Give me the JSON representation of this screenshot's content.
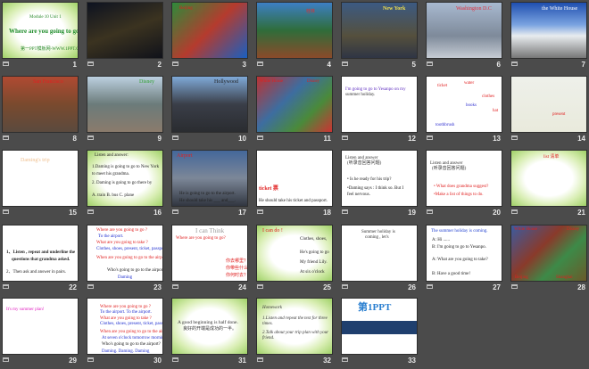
{
  "app": "slide-sorter",
  "slides": [
    {
      "num": "1",
      "kind": "green",
      "texts": [
        {
          "t": "Module 10 Unit 1",
          "c": "#2a8a2a",
          "x": 30,
          "y": 14
        },
        {
          "t": "Where are you going to go?",
          "c": "#1e8c2a",
          "x": 7,
          "y": 28,
          "b": 1,
          "s": 7
        },
        {
          "t": "第一PPT模板网-WWW.1PPT.COM",
          "c": "#2a8a2a",
          "x": 20,
          "y": 50
        }
      ]
    },
    {
      "num": "2",
      "kind": "photo1",
      "texts": []
    },
    {
      "num": "3",
      "kind": "photo2",
      "texts": [
        {
          "t": "Beijing",
          "c": "#e02020",
          "x": 8,
          "y": 4
        }
      ]
    },
    {
      "num": "4",
      "kind": "photo3",
      "texts": [
        {
          "t": "桂林",
          "c": "#e03030",
          "x": 55,
          "y": 8
        }
      ]
    },
    {
      "num": "5",
      "kind": "photo4",
      "texts": [
        {
          "t": "New York",
          "c": "#f0e050",
          "x": 46,
          "y": 4,
          "b": 1,
          "s": 6
        }
      ]
    },
    {
      "num": "6",
      "kind": "photo5",
      "texts": [
        {
          "t": "Washington D.C",
          "c": "#e03040",
          "x": 33,
          "y": 4,
          "s": 6
        }
      ]
    },
    {
      "num": "7",
      "kind": "photo6",
      "texts": [
        {
          "t": "the White House",
          "c": "#ffffff",
          "x": 34,
          "y": 4,
          "s": 6
        }
      ]
    },
    {
      "num": "8",
      "kind": "photo7",
      "texts": [
        {
          "t": "San Francisco",
          "c": "#e02020",
          "x": 34,
          "y": 3,
          "s": 6
        }
      ]
    },
    {
      "num": "9",
      "kind": "photo8",
      "texts": [
        {
          "t": "Disney",
          "c": "#30a030",
          "x": 58,
          "y": 3,
          "s": 6
        }
      ]
    },
    {
      "num": "10",
      "kind": "photo9",
      "texts": [
        {
          "t": "Hollywood",
          "c": "#222222",
          "x": 47,
          "y": 3,
          "s": 6
        }
      ]
    },
    {
      "num": "11",
      "kind": "photo10",
      "texts": [
        {
          "t": "White House",
          "c": "#e02020",
          "x": 3,
          "y": 3
        },
        {
          "t": "Disney",
          "c": "#e02020",
          "x": 56,
          "y": 3
        }
      ]
    },
    {
      "num": "12",
      "kind": "white",
      "texts": [
        {
          "t": "I'm going to go to Yesanpo on my",
          "c": "#6030c0",
          "x": 4,
          "y": 12
        },
        {
          "t": "summer holiday.",
          "c": "#333333",
          "x": 4,
          "y": 18
        }
      ]
    },
    {
      "num": "13",
      "kind": "white",
      "texts": [
        {
          "t": "ticket",
          "c": "#e02020",
          "x": 12,
          "y": 8
        },
        {
          "t": "water",
          "c": "#e02020",
          "x": 42,
          "y": 5
        },
        {
          "t": "clothes",
          "c": "#e02020",
          "x": 62,
          "y": 20
        },
        {
          "t": "hat",
          "c": "#e02020",
          "x": 74,
          "y": 36
        },
        {
          "t": "books",
          "c": "#3030d0",
          "x": 44,
          "y": 30
        },
        {
          "t": "toothbrush",
          "c": "#3030d0",
          "x": 10,
          "y": 52
        }
      ]
    },
    {
      "num": "14",
      "kind": "photo11",
      "texts": [
        {
          "t": "present",
          "c": "#e02020",
          "x": 46,
          "y": 40
        }
      ]
    },
    {
      "num": "15",
      "kind": "white",
      "texts": [
        {
          "t": "Daming's trip",
          "c": "#f0c090",
          "x": 20,
          "y": 8,
          "s": 6
        }
      ]
    },
    {
      "num": "16",
      "kind": "green",
      "texts": [
        {
          "t": "Listen and answer:",
          "c": "#222222",
          "x": 8,
          "y": 3
        },
        {
          "t": "1.Daming is going to go to New York",
          "c": "#222222",
          "x": 5,
          "y": 16
        },
        {
          "t": "to meet his grandma.",
          "c": "#222222",
          "x": 5,
          "y": 24
        },
        {
          "t": "2. Daming is going to go there by",
          "c": "#222222",
          "x": 5,
          "y": 34
        },
        {
          "t": "A. train   B. bus   C. plane",
          "c": "#222222",
          "x": 5,
          "y": 48
        }
      ]
    },
    {
      "num": "17",
      "kind": "photo12",
      "texts": [
        {
          "t": "Airport",
          "c": "#e02020",
          "x": 5,
          "y": 3,
          "s": 6
        },
        {
          "t": "He is going to go to the airport.",
          "c": "#222222",
          "x": 8,
          "y": 46
        },
        {
          "t": "He should take his ___ and___.",
          "c": "#222222",
          "x": 8,
          "y": 54
        }
      ]
    },
    {
      "num": "18",
      "kind": "white",
      "texts": [
        {
          "t": "ticket   票",
          "c": "#e02020",
          "x": 2,
          "y": 40,
          "b": 1,
          "s": 6
        },
        {
          "t": "He should take his ticket and passport.",
          "c": "#222222",
          "x": 2,
          "y": 54
        }
      ]
    },
    {
      "num": "19",
      "kind": "white",
      "texts": [
        {
          "t": "Listen and answer",
          "c": "#333333",
          "x": 4,
          "y": 6
        },
        {
          "t": "(听录音回答问题)",
          "c": "#333333",
          "x": 6,
          "y": 12
        },
        {
          "t": "• Is he ready for his trip?",
          "c": "#222222",
          "x": 6,
          "y": 30
        },
        {
          "t": "•Daming says : I think so. But I",
          "c": "#222222",
          "x": 6,
          "y": 40
        },
        {
          "t": "feel nervous.",
          "c": "#222222",
          "x": 6,
          "y": 47
        }
      ]
    },
    {
      "num": "20",
      "kind": "white",
      "texts": [
        {
          "t": "Listen and answer",
          "c": "#333333",
          "x": 4,
          "y": 12
        },
        {
          "t": "(听录音回答问题)",
          "c": "#333333",
          "x": 6,
          "y": 18
        },
        {
          "t": "• What does grandma suggest?",
          "c": "#e02020",
          "x": 8,
          "y": 38
        },
        {
          "t": "•Make a list of things to do.",
          "c": "#e02020",
          "x": 8,
          "y": 47
        }
      ]
    },
    {
      "num": "21",
      "kind": "green",
      "texts": [
        {
          "t": "list  清单",
          "c": "#e02020",
          "x": 36,
          "y": 5
        }
      ]
    },
    {
      "num": "22",
      "kind": "white",
      "texts": [
        {
          "t": "1、Listen , repeat and underline the",
          "c": "#222222",
          "x": 4,
          "y": 28,
          "b": 1
        },
        {
          "t": "questions that grandma asked.",
          "c": "#222222",
          "x": 10,
          "y": 36,
          "b": 1
        },
        {
          "t": "2、Then ask and answer in pairs.",
          "c": "#222222",
          "x": 4,
          "y": 50
        }
      ]
    },
    {
      "num": "23",
      "kind": "white",
      "texts": [
        {
          "t": "Where are you going to go ?",
          "c": "#e02020",
          "x": 10,
          "y": 3
        },
        {
          "t": "To the airport.",
          "c": "#2030d0",
          "x": 12,
          "y": 10
        },
        {
          "t": "What are you going to take ?",
          "c": "#e02020",
          "x": 10,
          "y": 17
        },
        {
          "t": "Clothes, shoes, present, ticket, passport,",
          "c": "#2030d0",
          "x": 10,
          "y": 24
        },
        {
          "t": "When are you going to go to the airport?",
          "c": "#e02020",
          "x": 10,
          "y": 34
        },
        {
          "t": "Who's going to go to the airport?",
          "c": "#222222",
          "x": 22,
          "y": 48
        },
        {
          "t": "Daming",
          "c": "#2030d0",
          "x": 34,
          "y": 56
        }
      ]
    },
    {
      "num": "24",
      "kind": "white",
      "texts": [
        {
          "t": "I can Think",
          "c": "#999999",
          "x": 26,
          "y": 2,
          "s": 7
        },
        {
          "t": "Where are you going to go?",
          "c": "#e02020",
          "x": 4,
          "y": 12
        },
        {
          "t": "你去哪里？",
          "c": "#e02020",
          "x": 60,
          "y": 38
        },
        {
          "t": "你带些什么？",
          "c": "#e02020",
          "x": 60,
          "y": 46
        },
        {
          "t": "你何时去？",
          "c": "#e02020",
          "x": 60,
          "y": 54
        }
      ]
    },
    {
      "num": "25",
      "kind": "green",
      "texts": [
        {
          "t": "I can do !",
          "c": "#e02020",
          "x": 6,
          "y": 3,
          "s": 6
        },
        {
          "t": "Clothes, shoes,",
          "c": "#222222",
          "x": 48,
          "y": 13
        },
        {
          "t": "He's going to go",
          "c": "#222222",
          "x": 48,
          "y": 28
        },
        {
          "t": "My friend Lily.",
          "c": "#222222",
          "x": 48,
          "y": 39
        },
        {
          "t": "At six o'clock",
          "c": "#222222",
          "x": 48,
          "y": 50
        }
      ]
    },
    {
      "num": "26",
      "kind": "white",
      "texts": [
        {
          "t": "Summer holiday is",
          "c": "#333333",
          "x": 22,
          "y": 5
        },
        {
          "t": "coming , let's",
          "c": "#333333",
          "x": 26,
          "y": 11
        }
      ]
    },
    {
      "num": "27",
      "kind": "white",
      "texts": [
        {
          "t": "The summer holiday is coming.",
          "c": "#2040d0",
          "x": 5,
          "y": 4,
          "s": 5
        },
        {
          "t": "A: Hi ......",
          "c": "#222222",
          "x": 6,
          "y": 14
        },
        {
          "t": "B: I'm going to go to Yesanpo.",
          "c": "#222222",
          "x": 6,
          "y": 22
        },
        {
          "t": "A: What are you going to take?",
          "c": "#222222",
          "x": 6,
          "y": 36
        },
        {
          "t": "B: Have a good time!",
          "c": "#222222",
          "x": 6,
          "y": 52
        }
      ]
    },
    {
      "num": "28",
      "kind": "photo13",
      "texts": [
        {
          "t": "White House",
          "c": "#e02020",
          "x": 3,
          "y": 2
        },
        {
          "t": "Disney",
          "c": "#e02020",
          "x": 62,
          "y": 2
        },
        {
          "t": "Beijing",
          "c": "#e02020",
          "x": 4,
          "y": 56
        },
        {
          "t": "Shanghai",
          "c": "#e02020",
          "x": 50,
          "y": 56
        }
      ]
    },
    {
      "num": "29",
      "kind": "white",
      "texts": [
        {
          "t": "It's my summer plan!",
          "c": "#e020c0",
          "x": 4,
          "y": 10
        }
      ]
    },
    {
      "num": "30",
      "kind": "white",
      "texts": [
        {
          "t": "Where are you going to go ?",
          "c": "#e02020",
          "x": 14,
          "y": 7
        },
        {
          "t": "To the airport. To the airport.",
          "c": "#2030d0",
          "x": 14,
          "y": 13
        },
        {
          "t": "What are you going to take ?",
          "c": "#e02020",
          "x": 14,
          "y": 20
        },
        {
          "t": "Clothes, shoes, present, ticket, passport,",
          "c": "#2030d0",
          "x": 14,
          "y": 26
        },
        {
          "t": "When are you going to go to the airport?",
          "c": "#e02020",
          "x": 14,
          "y": 35
        },
        {
          "t": "At seven o'clock  tomorrow morning.",
          "c": "#2030d0",
          "x": 16,
          "y": 42
        },
        {
          "t": "Who's going to go to the airport?",
          "c": "#222222",
          "x": 16,
          "y": 49
        },
        {
          "t": "Daming. Daming.  Daming",
          "c": "#2030d0",
          "x": 16,
          "y": 57
        }
      ]
    },
    {
      "num": "31",
      "kind": "green",
      "texts": [
        {
          "t": "A good beginning is half done.",
          "c": "#333333",
          "x": 6,
          "y": 24,
          "s": 5.5
        },
        {
          "t": "良好的开端是成功的一半。",
          "c": "#333333",
          "x": 12,
          "y": 32
        }
      ]
    },
    {
      "num": "32",
      "kind": "green",
      "texts": [
        {
          "t": "Homework",
          "c": "#333333",
          "x": 6,
          "y": 8,
          "i": 1
        },
        {
          "t": "1.Listen and repeat the text for three",
          "c": "#333333",
          "x": 6,
          "y": 20,
          "i": 1
        },
        {
          "t": "times.",
          "c": "#333333",
          "x": 6,
          "y": 26,
          "i": 1
        },
        {
          "t": "2.Talk about your trip plan with your",
          "c": "#333333",
          "x": 6,
          "y": 36,
          "i": 1
        },
        {
          "t": "friend.",
          "c": "#333333",
          "x": 6,
          "y": 42,
          "i": 1
        }
      ]
    },
    {
      "num": "33",
      "kind": "ppt",
      "texts": [
        {
          "t": "第1PPT",
          "c": "#2a7fd0",
          "x": 18,
          "y": 4,
          "b": 1,
          "s": 11
        }
      ]
    }
  ]
}
